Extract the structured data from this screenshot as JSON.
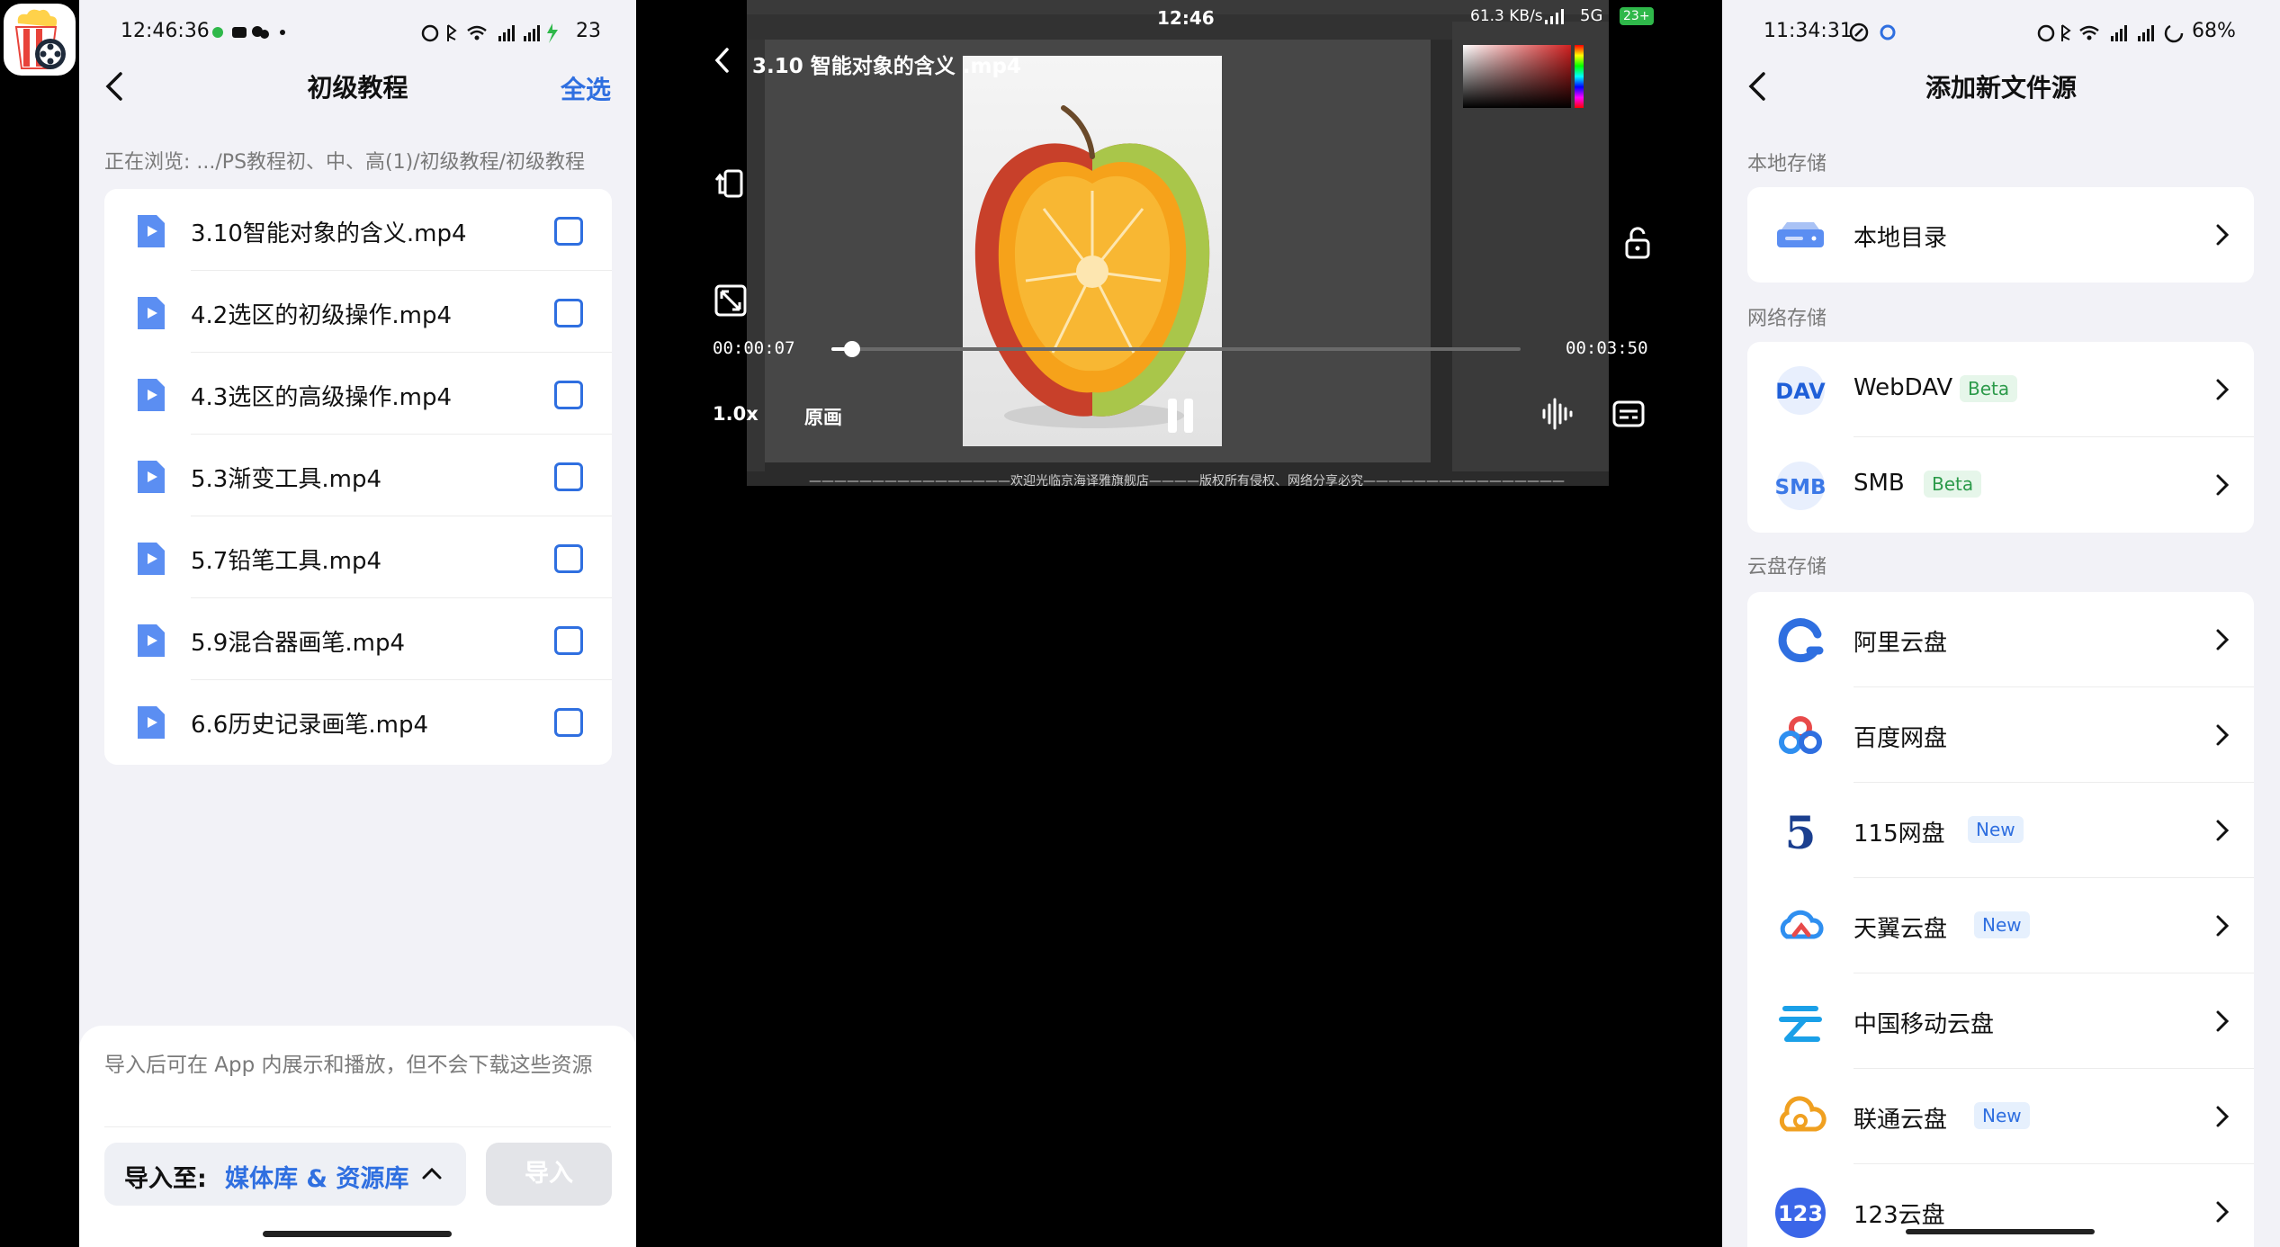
{
  "left": {
    "status_time": "12:46:36",
    "status_battery": "23",
    "title": "初级教程",
    "select_all": "全选",
    "browsing": "正在浏览: .../PS教程初、中、高(1)/初级教程/初级教程",
    "files": [
      {
        "name": "3.10智能对象的含义.mp4"
      },
      {
        "name": "4.2选区的初级操作.mp4"
      },
      {
        "name": "4.3选区的高级操作.mp4"
      },
      {
        "name": "5.3渐变工具.mp4"
      },
      {
        "name": "5.7铅笔工具.mp4"
      },
      {
        "name": "5.9混合器画笔.mp4"
      },
      {
        "name": "6.6历史记录画笔.mp4"
      }
    ],
    "sheet_note": "导入后可在 App 内展示和播放，但不会下载这些资源",
    "import_to_label": "导入至:",
    "import_to_value": "媒体库 & 资源库",
    "import_button": "导入"
  },
  "video": {
    "status_time": "12:46",
    "net_speed": "61.3 KB/s",
    "network": "5G",
    "battery": "23+",
    "title": "3.10 智能对象的含义 .mp4",
    "current_time": "00:00:07",
    "total_time": "00:03:50",
    "progress": 0.03,
    "speed": "1.0x",
    "quality": "原画",
    "ticker": "————————————————欢迎光临京海译雅旗舰店————版权所有侵权、网络分享必究————————————————"
  },
  "right": {
    "status_time": "11:34:31",
    "battery": "68%",
    "title": "添加新文件源",
    "local_section": "本地存储",
    "local_items": [
      {
        "name": "本地目录",
        "icon": "drive-icon"
      }
    ],
    "network_section": "网络存储",
    "network_items": [
      {
        "name": "WebDAV",
        "badge": "Beta",
        "icon": "webdav-icon"
      },
      {
        "name": "SMB",
        "badge": "Beta",
        "icon": "smb-icon"
      }
    ],
    "cloud_section": "云盘存储",
    "cloud_items": [
      {
        "name": "阿里云盘",
        "badge": "",
        "icon": "aliyun-icon"
      },
      {
        "name": "百度网盘",
        "badge": "",
        "icon": "baidu-icon"
      },
      {
        "name": "115网盘",
        "badge": "New",
        "icon": "115-icon"
      },
      {
        "name": "天翼云盘",
        "badge": "New",
        "icon": "tianyi-icon"
      },
      {
        "name": "中国移动云盘",
        "badge": "",
        "icon": "cmcc-icon"
      },
      {
        "name": "联通云盘",
        "badge": "New",
        "icon": "unicom-icon"
      },
      {
        "name": "123云盘",
        "badge": "",
        "icon": "123-icon"
      }
    ],
    "icon_texts": {
      "webdav": "DAV",
      "smb": "SMB",
      "pan123": "123",
      "num115": "5"
    }
  },
  "colors": {
    "accent": "#2f6fe0",
    "beta": "#2c9a4a"
  }
}
